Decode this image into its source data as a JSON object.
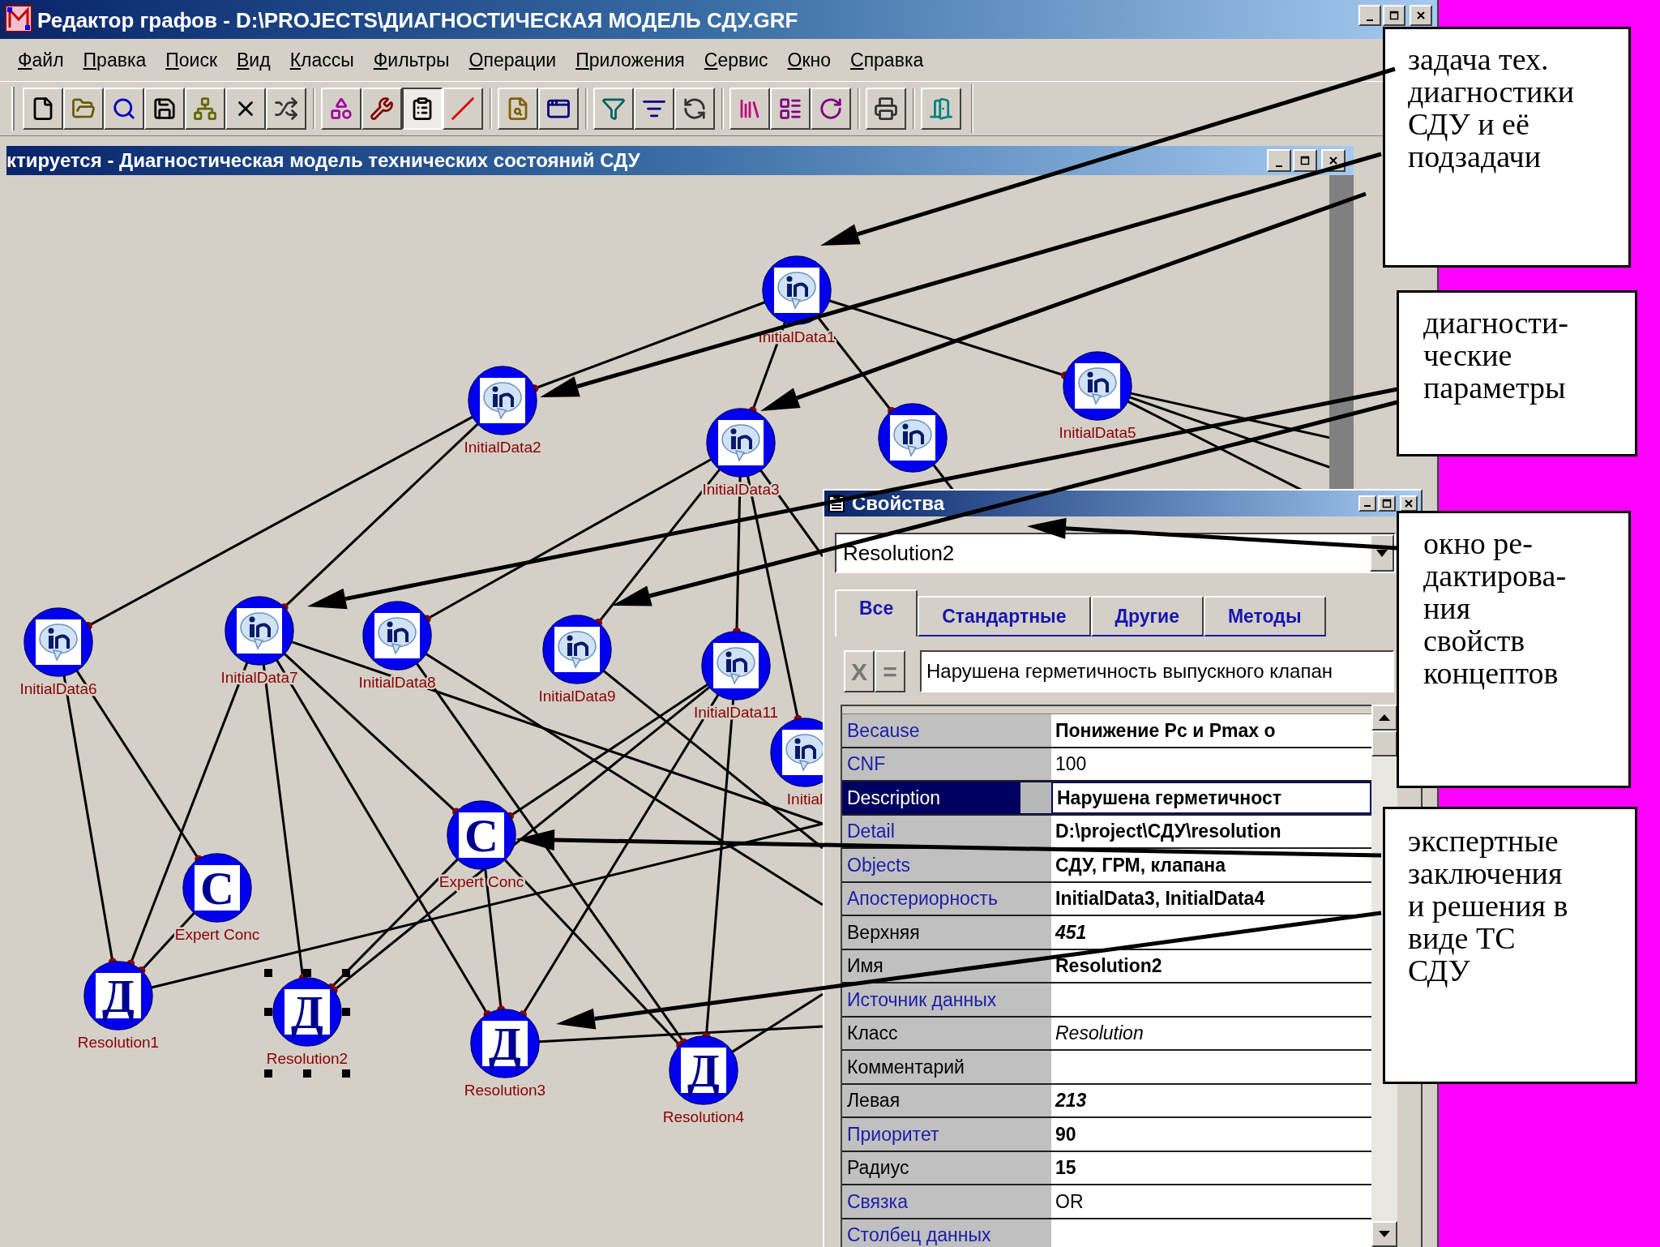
{
  "window": {
    "title": "Редактор графов - D:\\PROJECTS\\ДИАГНОСТИЧЕСКАЯ МОДЕЛЬ СДУ.GRF"
  },
  "menu": [
    "Файл",
    "Правка",
    "Поиск",
    "Вид",
    "Классы",
    "Фильтры",
    "Операции",
    "Приложения",
    "Сервис",
    "Окно",
    "Справка"
  ],
  "toolbar": [
    {
      "kind": "file",
      "pressed": false
    },
    {
      "kind": "open",
      "pressed": false
    },
    {
      "kind": "find",
      "pressed": false
    },
    {
      "kind": "save",
      "pressed": false
    },
    {
      "kind": "layout",
      "pressed": false
    },
    {
      "kind": "delete",
      "pressed": false
    },
    {
      "kind": "scatter",
      "pressed": false
    },
    {
      "kind": "shapes",
      "pressed": false
    },
    {
      "kind": "tools",
      "pressed": false
    },
    {
      "kind": "properties",
      "pressed": true
    },
    {
      "kind": "line",
      "pressed": false
    },
    {
      "kind": "search",
      "pressed": false
    },
    {
      "kind": "list",
      "pressed": false
    },
    {
      "kind": "filter",
      "pressed": false
    },
    {
      "kind": "filter_form",
      "pressed": false
    },
    {
      "kind": "filter_save",
      "pressed": false
    },
    {
      "kind": "books",
      "pressed": false
    },
    {
      "kind": "book_window",
      "pressed": false
    },
    {
      "kind": "book_save",
      "pressed": false
    },
    {
      "kind": "print",
      "pressed": false
    },
    {
      "kind": "exit",
      "pressed": false
    }
  ],
  "graph_window": {
    "title": "ктируется - Диагностическая модель технических состояний СДУ",
    "nodes": [
      {
        "kind": "info",
        "label": "InitialData1",
        "selected": false
      },
      {
        "kind": "info",
        "label": "InitialData2",
        "selected": false
      },
      {
        "kind": "info",
        "label": "InitialData3",
        "selected": false
      },
      {
        "kind": "info",
        "selected": false
      },
      {
        "kind": "info",
        "label": "InitialData5",
        "selected": false
      },
      {
        "kind": "info",
        "label": "InitialData6",
        "selected": false
      },
      {
        "kind": "info",
        "label": "InitialData7",
        "selected": false
      },
      {
        "kind": "info",
        "label": "InitialData8",
        "selected": false
      },
      {
        "kind": "info",
        "label": "InitialData9",
        "selected": false
      },
      {
        "kind": "info",
        "label": "InitialData11",
        "selected": false
      },
      {
        "kind": "info",
        "label": "Initial",
        "selected": false
      },
      {
        "kind": "letter",
        "symbol": "С",
        "label": "Expert Conc",
        "selected": false
      },
      {
        "kind": "letter",
        "symbol": "С",
        "label": "Expert Conc",
        "selected": false
      },
      {
        "kind": "letter",
        "symbol": "Д",
        "label": "Resolution1",
        "selected": false
      },
      {
        "kind": "letter",
        "symbol": "Д",
        "label": "Resolution2",
        "selected": true
      },
      {
        "kind": "letter",
        "symbol": "Д",
        "label": "Resolution3",
        "selected": false
      },
      {
        "kind": "letter",
        "symbol": "Д",
        "label": "Resolution4",
        "selected": false
      }
    ]
  },
  "properties": {
    "title": "Свойства",
    "object": "Resolution2",
    "tabs": [
      {
        "label": "Все",
        "selected": true
      },
      {
        "label": "Стандартные",
        "selected": false
      },
      {
        "label": "Другие",
        "selected": false
      },
      {
        "label": "Методы",
        "selected": false
      }
    ],
    "edit_buttons": [
      "X",
      "="
    ],
    "edit_value": "Нарушена герметичность выпускного клапан",
    "rows": [
      {
        "name": "Because",
        "value": "Понижение  Pc и Pmax о",
        "kind": "standard",
        "selected": false
      },
      {
        "name": "CNF",
        "value": "100",
        "kind": "standard",
        "selected": false
      },
      {
        "name": "Description",
        "value": "Нарушена герметичност",
        "kind": "standard",
        "selected": true
      },
      {
        "name": "Detail",
        "value": "D:\\project\\СДУ\\resolution",
        "kind": "standard",
        "selected": false
      },
      {
        "name": "Objects",
        "value": "СДУ, ГРМ, клапана",
        "kind": "standard",
        "selected": false
      },
      {
        "name": "Апостериорность",
        "value": "InitialData3, InitialData4",
        "kind": "standard",
        "selected": false
      },
      {
        "name": "Верхняя",
        "value": "451",
        "kind": "other",
        "selected": false
      },
      {
        "name": "Имя",
        "value": "Resolution2",
        "kind": "other",
        "selected": false
      },
      {
        "name": "Источник данных",
        "kind": "standard",
        "selected": false
      },
      {
        "name": "Класс",
        "value": "Resolution",
        "kind": "other",
        "selected": false
      },
      {
        "name": "Комментарий",
        "kind": "other",
        "selected": false
      },
      {
        "name": "Левая",
        "value": "213",
        "kind": "other",
        "selected": false
      },
      {
        "name": "Приоритет",
        "value": "90",
        "kind": "standard",
        "selected": false
      },
      {
        "name": "Радиус",
        "value": "15",
        "kind": "other",
        "selected": false
      },
      {
        "name": "Связка",
        "value": "OR",
        "kind": "standard",
        "selected": false
      },
      {
        "name": "Столбец данных",
        "kind": "standard",
        "selected": false
      }
    ]
  },
  "callouts": [
    {
      "text": "задача  тех.\nдиагностики\nСДУ и её\nподзадачи"
    },
    {
      "text": "диагности-\nческие\nпараметры"
    },
    {
      "text": "окно ре-\nдактирова-\nния\nсвойств\nконцептов"
    },
    {
      "text": "экспертные\nзаключения\nи решения в\nвиде ТС\nСДУ"
    }
  ]
}
